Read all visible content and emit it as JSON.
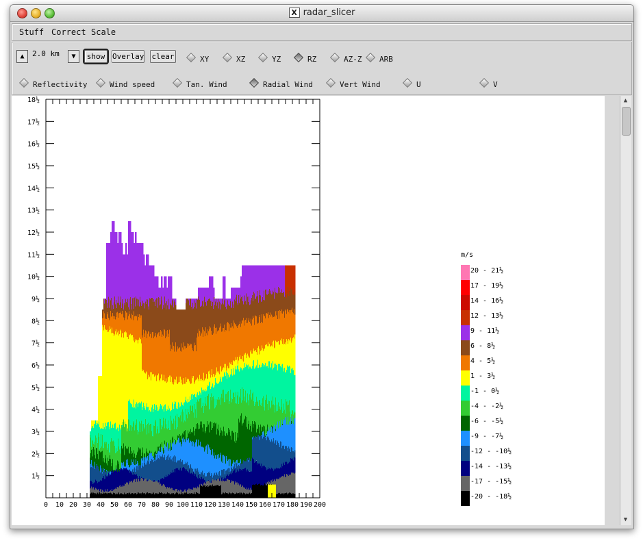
{
  "window": {
    "title": "radar_slicer"
  },
  "menu": [
    "Stuff",
    "Correct",
    "Scale"
  ],
  "toolbar": {
    "level_value": "2.0 km",
    "show_label": "show",
    "overlay_label": "Overlay",
    "clear_label": "clear",
    "view_modes": [
      "XY",
      "XZ",
      "YZ",
      "RZ",
      "AZ-Z",
      "ARB"
    ],
    "selected_view": "RZ",
    "fields": [
      "Reflectivity",
      "Wind speed",
      "Tan. Wind",
      "Radial Wind",
      "Vert Wind",
      "U",
      "V"
    ],
    "selected_field": "Radial Wind"
  },
  "chart_data": {
    "type": "heatmap",
    "title": "",
    "xlabel": "",
    "ylabel": "",
    "xlim": [
      0,
      200
    ],
    "ylim": [
      0,
      18
    ],
    "x_ticks": [
      "0",
      "10",
      "20",
      "30",
      "40",
      "50",
      "60",
      "70",
      "80",
      "90",
      "100",
      "110",
      "120",
      "130",
      "140",
      "150",
      "160",
      "170",
      "180",
      "190",
      "200"
    ],
    "y_ticks": [
      "1½",
      "2½",
      "3½",
      "4½",
      "5½",
      "6½",
      "7½",
      "8½",
      "9½",
      "10½",
      "11½",
      "12½",
      "13½",
      "14½",
      "15½",
      "16½",
      "17½",
      "18½"
    ],
    "legend_unit": "m/s",
    "legend": [
      {
        "label": "20 - 21½",
        "color": "#ff77b3"
      },
      {
        "label": "17 - 19½",
        "color": "#ff0000"
      },
      {
        "label": "14 - 16½",
        "color": "#cc0a00"
      },
      {
        "label": "12 - 13½",
        "color": "#c83000"
      },
      {
        "label": "9 - 11½",
        "color": "#9b30e8"
      },
      {
        "label": "6 - 8½",
        "color": "#8b4a1a"
      },
      {
        "label": "4 - 5½",
        "color": "#f07800"
      },
      {
        "label": "1 - 3½",
        "color": "#ffff00"
      },
      {
        "label": "-1 - 0½",
        "color": "#00f5a0"
      },
      {
        "label": "-4 - -2½",
        "color": "#33cc33"
      },
      {
        "label": "-6 - -5½",
        "color": "#006600"
      },
      {
        "label": "-9 - -7½",
        "color": "#1e90ff"
      },
      {
        "label": "-12 - -10½",
        "color": "#124e8c"
      },
      {
        "label": "-14 - -13½",
        "color": "#000080"
      },
      {
        "label": "-17 - -15½",
        "color": "#666666"
      },
      {
        "label": "-20 - -18½",
        "color": "#000000"
      }
    ],
    "columns": {
      "x_start": 32,
      "x_step": 1,
      "top_height_km": [
        3.0,
        3.5,
        3.5,
        3.5,
        3.5,
        3.5,
        5.5,
        5.5,
        5.5,
        8.5,
        9.0,
        9.0,
        11.5,
        11.5,
        11.5,
        12.0,
        12.5,
        12.5,
        12.0,
        12.0,
        11.5,
        12.0,
        12.0,
        11.5,
        11.0,
        11.0,
        11.5,
        11.0,
        12.5,
        12.5,
        12.0,
        12.0,
        11.5,
        12.0,
        11.5,
        11.5,
        11.5,
        11.5,
        11.5,
        11.0,
        10.5,
        11.0,
        11.0,
        10.5,
        10.5,
        10.5,
        10.5,
        10.0,
        10.0,
        10.0,
        9.5,
        9.5,
        10.0,
        9.5,
        10.0,
        10.0,
        9.5,
        10.0,
        10.0,
        10.0,
        9.0,
        9.0,
        9.0,
        8.5,
        8.5,
        8.5,
        8.5,
        8.5,
        8.5,
        8.5,
        9.0,
        9.0,
        9.0,
        9.0,
        9.0,
        9.0,
        9.0,
        9.0,
        9.0,
        9.5,
        9.5,
        9.5,
        9.5,
        9.5,
        9.5,
        9.5,
        9.5,
        10.0,
        10.0,
        10.0,
        9.5,
        9.0,
        9.0,
        9.0,
        9.0,
        9.0,
        9.0,
        10.0,
        10.0,
        9.0,
        9.0,
        9.0,
        9.0,
        9.5,
        9.5,
        9.5,
        9.5,
        9.5,
        9.5,
        9.5,
        10.0,
        10.5,
        10.5,
        10.5,
        10.5,
        10.5,
        10.5,
        10.5,
        10.5,
        10.5,
        10.5,
        10.5,
        10.5,
        10.5,
        10.5,
        10.5,
        10.5,
        10.5,
        10.5,
        10.5,
        10.5,
        10.5,
        10.5,
        10.5,
        10.5,
        10.5,
        10.5,
        10.5,
        10.5,
        10.5,
        10.5,
        10.5,
        10.5,
        10.5,
        10.5,
        10.5,
        10.5,
        10.5,
        10.5,
        10.5
      ],
      "x_end": 182
    }
  }
}
